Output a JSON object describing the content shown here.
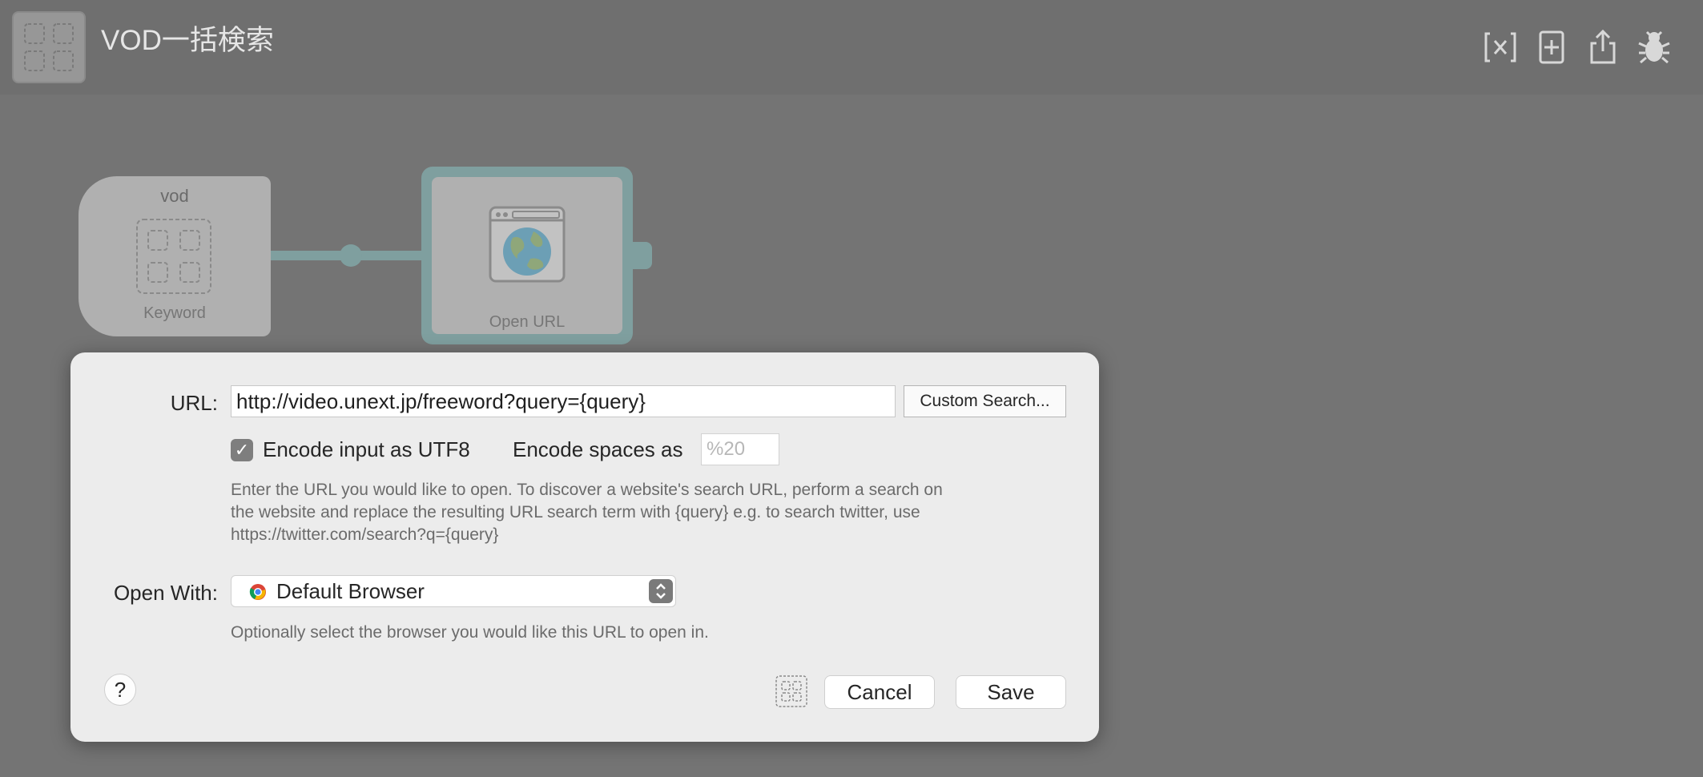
{
  "header": {
    "title": "VOD一括検索",
    "workflow_icon": "dashed-grid-icon",
    "actions": [
      {
        "name": "variables-icon"
      },
      {
        "name": "add-object-icon"
      },
      {
        "name": "share-icon"
      },
      {
        "name": "debug-icon"
      }
    ]
  },
  "canvas": {
    "keyword_node": {
      "keyword": "vod",
      "type_label": "Keyword",
      "icon": "dashed-grid-icon"
    },
    "openurl_node": {
      "type_label": "Open URL",
      "icon": "browser-globe-icon"
    }
  },
  "dialog": {
    "url_label": "URL:",
    "url_value": "http://video.unext.jp/freeword?query={query}",
    "custom_search_label": "Custom Search...",
    "encode_utf8_checked": true,
    "encode_utf8_label": "Encode input as UTF8",
    "encode_spaces_label": "Encode spaces as",
    "encode_spaces_placeholder": "%20",
    "help_line1": "Enter the URL you would like to open. To discover a website's search URL, perform a search on",
    "help_line2": "the website and replace the resulting URL search term with {query} e.g. to search twitter, use",
    "help_line3": "https://twitter.com/search?q={query}",
    "open_with_label": "Open With:",
    "open_with_value": "Default Browser",
    "open_with_hint": "Optionally select the browser you would like this URL to open in.",
    "help_button": "?",
    "cancel_label": "Cancel",
    "save_label": "Save"
  },
  "colors": {
    "background": "#747474",
    "dialog": "#ececec",
    "connection": "#7f9f9f"
  }
}
